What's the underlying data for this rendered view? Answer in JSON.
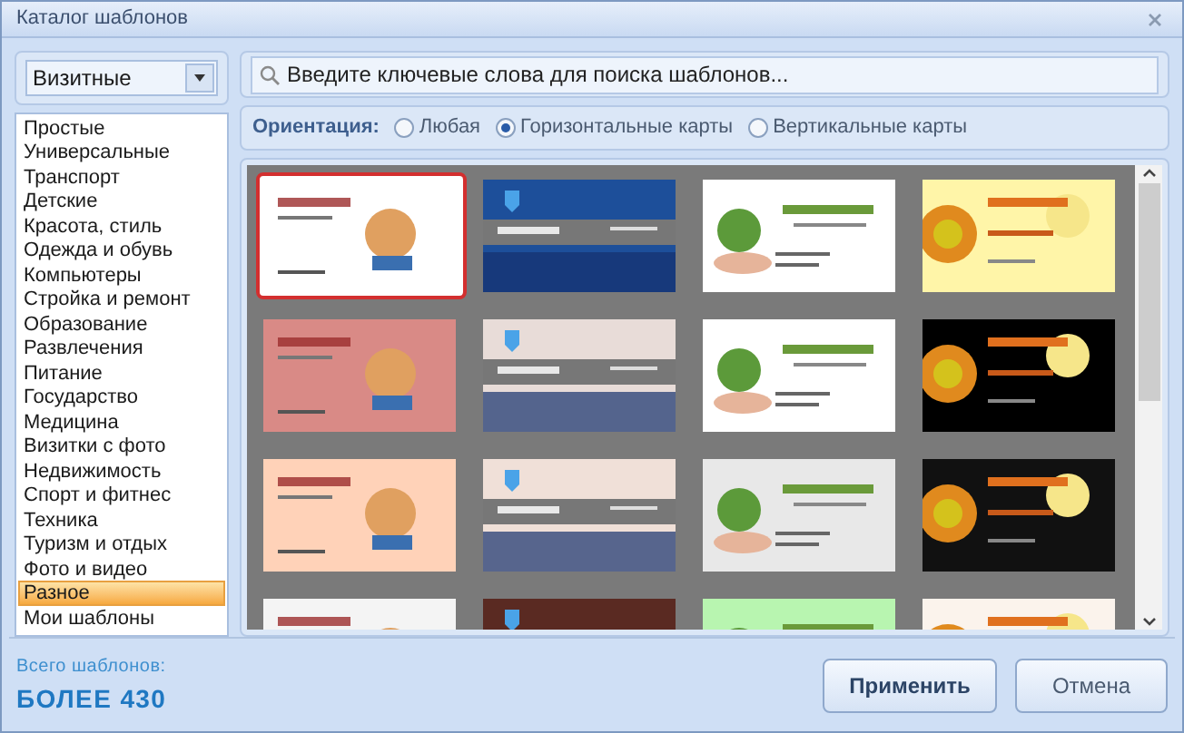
{
  "window": {
    "title": "Каталог шаблонов"
  },
  "category_select": {
    "value": "Визитные"
  },
  "categories": [
    {
      "label": "Простые",
      "selected": false
    },
    {
      "label": "Универсальные",
      "selected": false
    },
    {
      "label": "Транспорт",
      "selected": false
    },
    {
      "label": "Детские",
      "selected": false
    },
    {
      "label": "Красота, стиль",
      "selected": false
    },
    {
      "label": "Одежда и обувь",
      "selected": false
    },
    {
      "label": "Компьютеры",
      "selected": false
    },
    {
      "label": "Стройка и ремонт",
      "selected": false
    },
    {
      "label": "Образование",
      "selected": false
    },
    {
      "label": "Развлечения",
      "selected": false
    },
    {
      "label": "Питание",
      "selected": false
    },
    {
      "label": "Государство",
      "selected": false
    },
    {
      "label": "Медицина",
      "selected": false
    },
    {
      "label": "Визитки с фото",
      "selected": false
    },
    {
      "label": "Недвижимость",
      "selected": false
    },
    {
      "label": "Спорт и фитнес",
      "selected": false
    },
    {
      "label": "Техника",
      "selected": false
    },
    {
      "label": "Туризм и отдых",
      "selected": false
    },
    {
      "label": "Фото и видео",
      "selected": false
    },
    {
      "label": "Разное",
      "selected": true
    },
    {
      "label": "Мои шаблоны",
      "selected": false
    }
  ],
  "search": {
    "placeholder": "Введите ключевые слова для поиска шаблонов..."
  },
  "orientation": {
    "label": "Ориентация:",
    "options": [
      {
        "label": "Любая",
        "selected": false
      },
      {
        "label": "Горизонтальные карты",
        "selected": true
      },
      {
        "label": "Вертикальные карты",
        "selected": false
      }
    ]
  },
  "templates": [
    {
      "kind": "picture",
      "selected": true,
      "color": "#ffffff"
    },
    {
      "kind": "picture",
      "selected": false,
      "color": "#1d4f9a"
    },
    {
      "kind": "picture",
      "selected": false,
      "color": "#ffffff"
    },
    {
      "kind": "picture",
      "selected": false,
      "color": "#fff5a8"
    },
    {
      "kind": "picture",
      "selected": false,
      "color": "#d98a86"
    },
    {
      "kind": "picture",
      "selected": false,
      "color": "#e8dcd8"
    },
    {
      "kind": "picture",
      "selected": false,
      "color": "#ffffff"
    },
    {
      "kind": "picture",
      "selected": false,
      "color": "#000000"
    },
    {
      "kind": "picture",
      "selected": false,
      "color": "#ffd2b8"
    },
    {
      "kind": "picture",
      "selected": false,
      "color": "#f0e0d8"
    },
    {
      "kind": "picture",
      "selected": false,
      "color": "#e8e8e8"
    },
    {
      "kind": "picture",
      "selected": false,
      "color": "#111111"
    },
    {
      "kind": "picture",
      "selected": false,
      "color": "#f4f4f4"
    },
    {
      "kind": "picture",
      "selected": false,
      "color": "#5a2a22"
    },
    {
      "kind": "picture",
      "selected": false,
      "color": "#b8f5b0"
    },
    {
      "kind": "picture",
      "selected": false,
      "color": "#fbf3ec"
    }
  ],
  "totals": {
    "label": "Всего шаблонов:",
    "value": "БОЛЕЕ 430"
  },
  "buttons": [
    {
      "label": "Применить",
      "kind": "primary"
    },
    {
      "label": "Отмена",
      "kind": "secondary"
    }
  ]
}
